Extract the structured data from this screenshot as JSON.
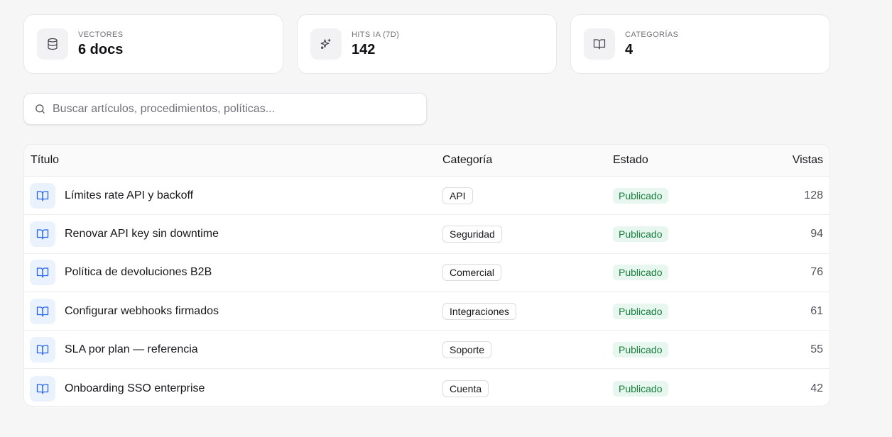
{
  "stats": [
    {
      "label": "VECTORES",
      "value": "6 docs",
      "icon": "database-icon"
    },
    {
      "label": "HITS IA (7D)",
      "value": "142",
      "icon": "sparkles-icon"
    },
    {
      "label": "CATEGORÍAS",
      "value": "4",
      "icon": "book-open-icon"
    }
  ],
  "search": {
    "placeholder": "Buscar artículos, procedimientos, políticas...",
    "value": ""
  },
  "table": {
    "headers": {
      "title": "Título",
      "category": "Categoría",
      "state": "Estado",
      "views": "Vistas"
    },
    "rows": [
      {
        "title": "Límites rate API y backoff",
        "category": "API",
        "state": "Publicado",
        "views": "128"
      },
      {
        "title": "Renovar API key sin downtime",
        "category": "Seguridad",
        "state": "Publicado",
        "views": "94"
      },
      {
        "title": "Política de devoluciones B2B",
        "category": "Comercial",
        "state": "Publicado",
        "views": "76"
      },
      {
        "title": "Configurar webhooks firmados",
        "category": "Integraciones",
        "state": "Publicado",
        "views": "61"
      },
      {
        "title": "SLA por plan — referencia",
        "category": "Soporte",
        "state": "Publicado",
        "views": "55"
      },
      {
        "title": "Onboarding SSO enterprise",
        "category": "Cuenta",
        "state": "Publicado",
        "views": "42"
      }
    ]
  },
  "colors": {
    "accent": "#2563eb",
    "published_bg": "#e7f6ee",
    "published_text": "#17803d"
  }
}
